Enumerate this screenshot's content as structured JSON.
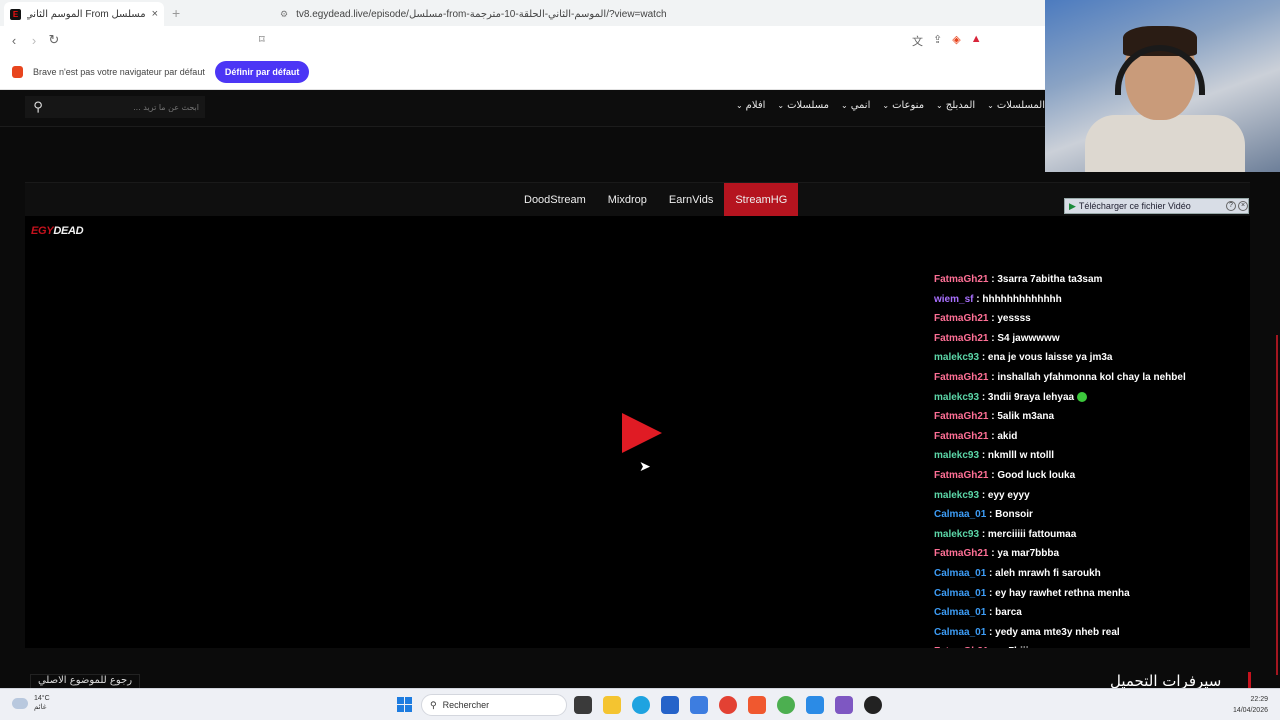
{
  "browser": {
    "tab_title": "مسلسل From الموسم الثاني الحلقة",
    "tab_close": "×",
    "new_tab": "+",
    "url": "tv8.egydead.live/episode/مسلسل-from-الموسم-الثاني-الحلقة-10-مترجمة/?view=watch",
    "infobar_text": "Brave n'est pas votre navigateur par défaut",
    "infobar_button": "Définir par défaut"
  },
  "site": {
    "search_placeholder": "ابحث عن ما تريد ...",
    "menu": [
      {
        "label": "المسلسلات"
      },
      {
        "label": "المدبلج"
      },
      {
        "label": "منوعات"
      },
      {
        "label": "انمي"
      },
      {
        "label": "مسلسلات"
      },
      {
        "label": "افلام"
      }
    ],
    "servers": [
      {
        "label": "DoodStream",
        "active": false
      },
      {
        "label": "Mixdrop",
        "active": false
      },
      {
        "label": "EarnVids",
        "active": false
      },
      {
        "label": "StreamHG",
        "active": true
      }
    ],
    "logo_part1": "EGY",
    "logo_part2": "DEAD",
    "download_overlay": "Télécharger ce fichier Vidéo",
    "back_link": "رجوع للموضوع الاصلي",
    "download_heading": "سيرفرات التحميل"
  },
  "chat": {
    "colors": {
      "FatmaGh21": "#ff7096",
      "wiem_sf": "#a970ff",
      "malekc93": "#5cd6a8",
      "Calmaa_01": "#3d9cf5"
    },
    "messages": [
      {
        "user": "FatmaGh21",
        "text": ": 3sarra 7abitha ta3sam"
      },
      {
        "user": "wiem_sf",
        "text": ": hhhhhhhhhhhhh"
      },
      {
        "user": "FatmaGh21",
        "text": ": yessss"
      },
      {
        "user": "FatmaGh21",
        "text": ": S4 jawwwww"
      },
      {
        "user": "malekc93",
        "text": ": ena je vous laisse ya jm3a"
      },
      {
        "user": "FatmaGh21",
        "text": ": inshallah yfahmonna kol chay la nehbel"
      },
      {
        "user": "malekc93",
        "text": ": 3ndii 9raya lehyaa",
        "emote": true
      },
      {
        "user": "FatmaGh21",
        "text": ": 5alik m3ana"
      },
      {
        "user": "FatmaGh21",
        "text": ": akid"
      },
      {
        "user": "malekc93",
        "text": ": nkmlll w ntolll"
      },
      {
        "user": "FatmaGh21",
        "text": ": Good luck louka"
      },
      {
        "user": "malekc93",
        "text": ": eyy eyyy"
      },
      {
        "user": "Calmaa_01",
        "text": ": Bonsoir"
      },
      {
        "user": "malekc93",
        "text": ": merciiiii fattoumaa"
      },
      {
        "user": "FatmaGh21",
        "text": ": ya mar7bbba"
      },
      {
        "user": "Calmaa_01",
        "text": ": aleh mrawh fi saroukh"
      },
      {
        "user": "Calmaa_01",
        "text": ": ey hay rawhet rethna menha"
      },
      {
        "user": "Calmaa_01",
        "text": ": barca"
      },
      {
        "user": "Calmaa_01",
        "text": ": yedy ama mte3y nheb real"
      },
      {
        "user": "FatmaGh21",
        "text": ": sa7biii"
      },
      {
        "user": "FatmaGh21",
        "text": ": 🦋"
      }
    ]
  },
  "taskbar": {
    "weather_temp": "14°C",
    "weather_desc": "غائم",
    "search_label": "Rechercher",
    "time": "22:29",
    "date": "14/04/2026"
  }
}
